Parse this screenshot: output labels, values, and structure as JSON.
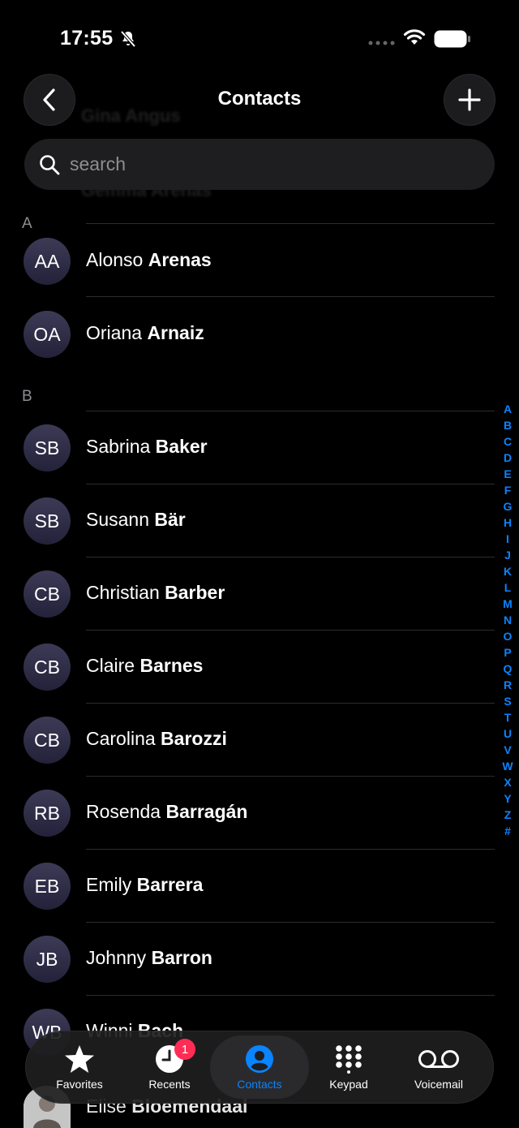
{
  "status": {
    "time": "17:55"
  },
  "nav": {
    "title": "Contacts"
  },
  "search": {
    "placeholder": "search"
  },
  "ghost_rows": [
    "Gina Angus",
    "Gemma Arenas"
  ],
  "sections": [
    {
      "letter": "A"
    },
    {
      "letter": "B"
    }
  ],
  "contacts": [
    {
      "initials": "AA",
      "first": "Alonso",
      "last": "Arenas"
    },
    {
      "initials": "OA",
      "first": "Oriana",
      "last": "Arnaiz"
    },
    {
      "initials": "SB",
      "first": "Sabrina",
      "last": "Baker"
    },
    {
      "initials": "SB",
      "first": "Susann",
      "last": "Bär"
    },
    {
      "initials": "CB",
      "first": "Christian",
      "last": "Barber"
    },
    {
      "initials": "CB",
      "first": "Claire",
      "last": "Barnes"
    },
    {
      "initials": "CB",
      "first": "Carolina",
      "last": "Barozzi"
    },
    {
      "initials": "RB",
      "first": "Rosenda",
      "last": "Barragán"
    },
    {
      "initials": "EB",
      "first": "Emily",
      "last": "Barrera"
    },
    {
      "initials": "JB",
      "first": "Johnny",
      "last": "Barron"
    },
    {
      "initials": "WB",
      "first": "Winni",
      "last": "Bach"
    }
  ],
  "peek_contact": {
    "first": "Elise",
    "last": "Bloemendaal"
  },
  "index_letters": [
    "A",
    "B",
    "C",
    "D",
    "E",
    "F",
    "G",
    "H",
    "I",
    "J",
    "K",
    "L",
    "M",
    "N",
    "O",
    "P",
    "Q",
    "R",
    "S",
    "T",
    "U",
    "V",
    "W",
    "X",
    "Y",
    "Z",
    "#"
  ],
  "tabs": [
    {
      "label": "Favorites",
      "icon": "star-icon"
    },
    {
      "label": "Recents",
      "icon": "clock-icon",
      "badge": "1"
    },
    {
      "label": "Contacts",
      "icon": "person-circle-icon",
      "active": true
    },
    {
      "label": "Keypad",
      "icon": "keypad-icon"
    },
    {
      "label": "Voicemail",
      "icon": "voicemail-icon"
    }
  ],
  "colors": {
    "accent": "#0a84ff",
    "badge": "#ff2d55",
    "background": "#000000"
  }
}
